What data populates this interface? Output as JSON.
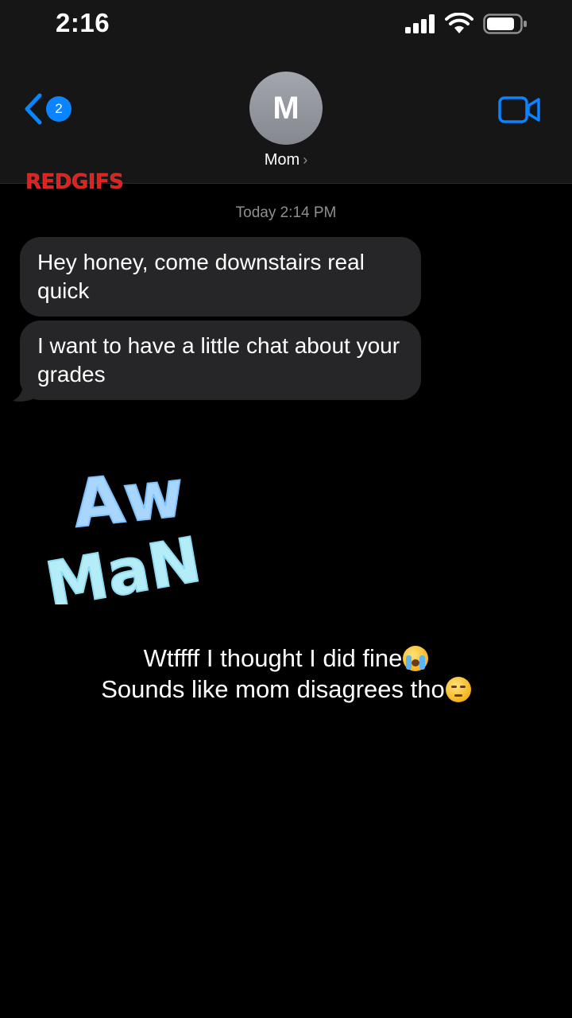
{
  "status_bar": {
    "time": "2:16",
    "signal_icon": "cellular-signal-icon",
    "wifi_icon": "wifi-icon",
    "battery_icon": "battery-icon"
  },
  "nav": {
    "back_icon": "chevron-left-icon",
    "unread_count": "2",
    "contact_initial": "M",
    "contact_name": "Mom",
    "contact_chevron": "›",
    "video_icon": "video-camera-icon",
    "accent_color": "#0a84ff"
  },
  "watermark": {
    "text": "REDGIFS",
    "color": "#e0201c"
  },
  "conversation": {
    "timestamp": "Today 2:14 PM",
    "messages": [
      {
        "sender": "Mom",
        "text": "Hey honey, come downstairs real quick"
      },
      {
        "sender": "Mom",
        "text": "I want to have a little chat about your grades"
      }
    ]
  },
  "sticker": {
    "line1": "Aw",
    "line2": "MaN",
    "color": "#a8dcff"
  },
  "caption": {
    "line1": "Wtffff I thought I did fine",
    "line1_emoji": "loudly-crying-face-emoji",
    "line2": "Sounds like mom disagrees tho",
    "line2_emoji": "pensive-face-emoji"
  }
}
